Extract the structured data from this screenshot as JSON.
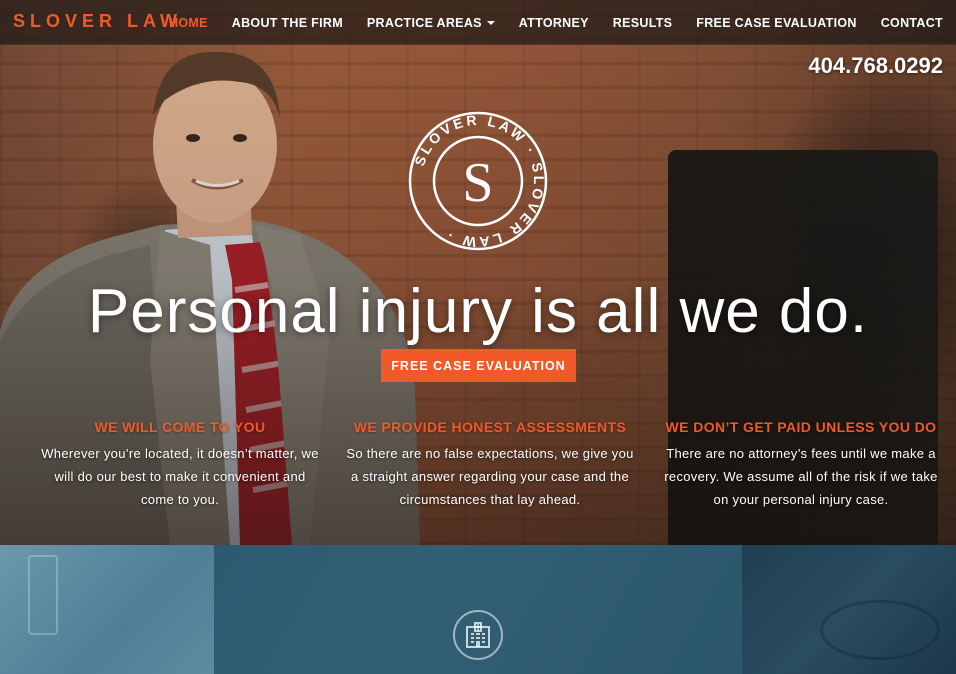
{
  "brand": {
    "name": "SLOVER LAW",
    "accent_color": "#f05a28"
  },
  "nav": {
    "items": [
      {
        "label": "HOME",
        "active": true
      },
      {
        "label": "ABOUT THE FIRM",
        "active": false
      },
      {
        "label": "PRACTICE AREAS",
        "active": false,
        "has_dropdown": true
      },
      {
        "label": "ATTORNEY",
        "active": false
      },
      {
        "label": "RESULTS",
        "active": false
      },
      {
        "label": "FREE CASE EVALUATION",
        "active": false
      },
      {
        "label": "CONTACT",
        "active": false
      }
    ]
  },
  "header": {
    "phone": "404.768.0292"
  },
  "seal": {
    "ring_text": "SLOVER LAW · SLOVER LAW ·",
    "letter": "S"
  },
  "hero": {
    "headline": "Personal injury is all we do.",
    "cta_label": "FREE CASE EVALUATION"
  },
  "features": [
    {
      "title": "WE WILL COME TO YOU",
      "text": "Wherever you’re located, it doesn’t matter, we will do our best to make it convenient and come to you."
    },
    {
      "title": "WE PROVIDE HONEST ASSESSMENTS",
      "text": "So there are no false expectations, we give you a straight answer regarding your case and the circumstances that lay ahead."
    },
    {
      "title": "WE DON’T GET PAID UNLESS YOU DO",
      "text": "There are no attorney’s fees until we make a recovery. We assume all of the risk if we take on your personal injury case."
    }
  ],
  "panels": {
    "center_icon": "hospital-icon"
  }
}
